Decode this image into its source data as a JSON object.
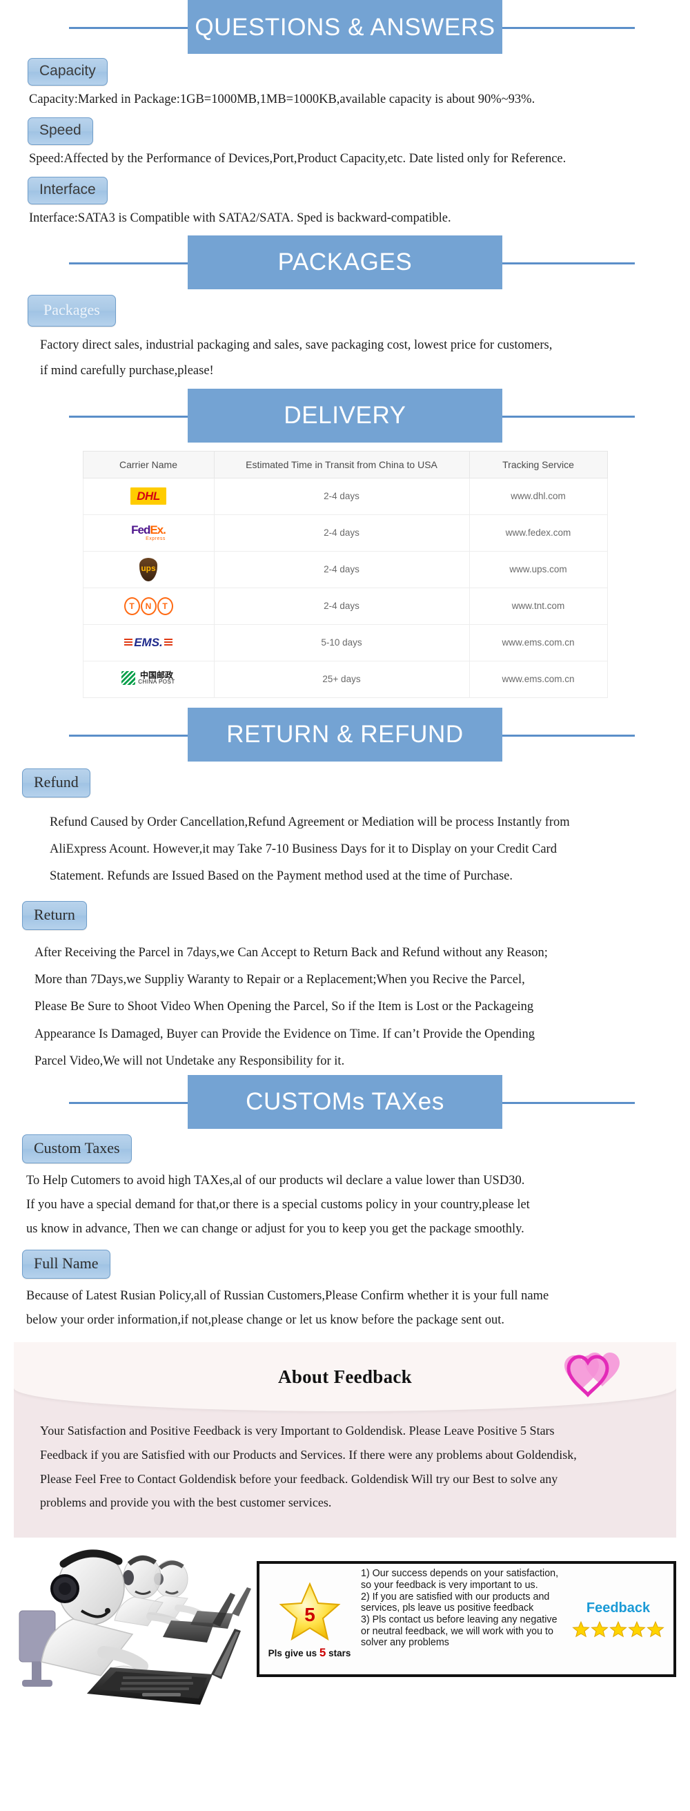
{
  "colors": {
    "banner_plate": "#74a3d3",
    "banner_rule": "#5b8fc9",
    "pill_fill": "#a9c9e6",
    "pill_border": "#6f9ecb",
    "feedback_panel": "#f2e7e9",
    "feedback_head": "#fbf5f4",
    "heart": "#f06ec8",
    "feedback_accent": "#1a9ad6",
    "star_gold": "#ffd400"
  },
  "sections": {
    "qa": {
      "banner": "QUESTIONS & ANSWERS",
      "items": [
        {
          "label": "Capacity",
          "text": "Capacity:Marked in Package:1GB=1000MB,1MB=1000KB,available capacity is about 90%~93%."
        },
        {
          "label": "Speed",
          "text": "Speed:Affected by the Performance of Devices,Port,Product Capacity,etc. Date listed only for Reference."
        },
        {
          "label": "Interface",
          "text": "Interface:SATA3 is Compatible with SATA2/SATA. Sped is backward-compatible."
        }
      ]
    },
    "packages": {
      "banner": "PACKAGES",
      "label": "Packages",
      "lines": [
        "Factory direct sales, industrial packaging and sales, save packaging cost, lowest price for customers,",
        "if mind carefully purchase,please!"
      ]
    },
    "delivery": {
      "banner": "DELIVERY",
      "table": {
        "columns": [
          "Carrier Name",
          "Estimated Time in Transit from China to USA",
          "Tracking Service"
        ],
        "rows": [
          {
            "carrier": "DHL",
            "carrier_icon": "dhl-logo",
            "transit": "2-4 days",
            "tracking": "www.dhl.com"
          },
          {
            "carrier": "FedEx Express",
            "carrier_icon": "fedex-logo",
            "transit": "2-4 days",
            "tracking": "www.fedex.com"
          },
          {
            "carrier": "UPS",
            "carrier_icon": "ups-logo",
            "transit": "2-4 days",
            "tracking": "www.ups.com"
          },
          {
            "carrier": "TNT",
            "carrier_icon": "tnt-logo",
            "transit": "2-4 days",
            "tracking": "www.tnt.com"
          },
          {
            "carrier": "EMS",
            "carrier_icon": "ems-logo",
            "transit": "5-10 days",
            "tracking": "www.ems.com.cn"
          },
          {
            "carrier": "CHINA POST",
            "carrier_icon": "china-post-logo",
            "transit": "25+ days",
            "tracking": "www.ems.com.cn"
          }
        ],
        "logo_text": {
          "dhl": "DHL",
          "fedex_fed": "Fed",
          "fedex_ex": "Ex.",
          "fedex_sub": "Express",
          "ups": "ups",
          "tnt_t1": "T",
          "tnt_n": "N",
          "tnt_t2": "T",
          "ems": "EMS.",
          "cp_cn": "中国邮政",
          "cp_en": "CHINA POST"
        }
      }
    },
    "return_refund": {
      "banner": "RETURN & REFUND",
      "refund": {
        "label": "Refund",
        "lines": [
          "Refund Caused by Order Cancellation,Refund Agreement or Mediation will be process Instantly from",
          "AliExpress Acount. However,it may Take 7-10 Business Days for it to Display on your Credit Card",
          "Statement. Refunds are Issued Based on the Payment method used at the time of Purchase."
        ]
      },
      "ret": {
        "label": "Return",
        "lines": [
          "After Receiving the Parcel in 7days,we Can Accept to Return Back and Refund without any Reason;",
          "More than 7Days,we Suppliy Waranty to Repair or a Replacement;When you Recive the Parcel,",
          "Please Be Sure to Shoot Video When Opening  the Parcel, So if the Item is Lost or the Packageing",
          "Appearance Is Damaged, Buyer can Provide the Evidence on Time. If can’t Provide the Opending",
          "Parcel Video,We will not Undetake any Responsibility for it."
        ]
      }
    },
    "customs": {
      "banner": "CUSTOMs TAXes",
      "taxes": {
        "label": "Custom Taxes",
        "lines": [
          "To Help Cutomers to avoid high TAXes,al of our products wil declare a value lower than USD30.",
          "If you have a special demand for that,or there is a special customs policy in your country,please let",
          "us know in advance, Then we can change or adjust for you to keep you get the package smoothly."
        ]
      },
      "fullname": {
        "label": "Full Name",
        "lines": [
          "Because of Latest Rusian Policy,all of Russian Customers,Please Confirm whether it is your full name",
          "below your order information,if not,please change or let us know before the package sent out."
        ]
      }
    },
    "feedback": {
      "title": "About Feedback",
      "lines": [
        "Your Satisfaction and Positive Feedback is very Important to Goldendisk. Please Leave Positive 5 Stars",
        "Feedback if you are Satisfied with our Products and Services. If there were any problems about Goldendisk,",
        "Please Feel Free to Contact Goldendisk before your feedback. Goldendisk Will try our Best to solve any",
        "problems and provide you with the best customer services."
      ]
    },
    "bottom_banner": {
      "star_number": "5",
      "caption_pre": "Pls give us",
      "caption_num": "5",
      "caption_post": "stars",
      "points": [
        "1) Our success depends on your satisfaction, so your feedback is very important to us.",
        "2) If you are satisfied with our products and services, pls leave us positive feedback",
        "3) Pls contact us before leaving any negative or neutral feedback, we will work with you to solver any problems"
      ],
      "feedback_title": "Feedback",
      "stars": "★★★★★"
    }
  }
}
